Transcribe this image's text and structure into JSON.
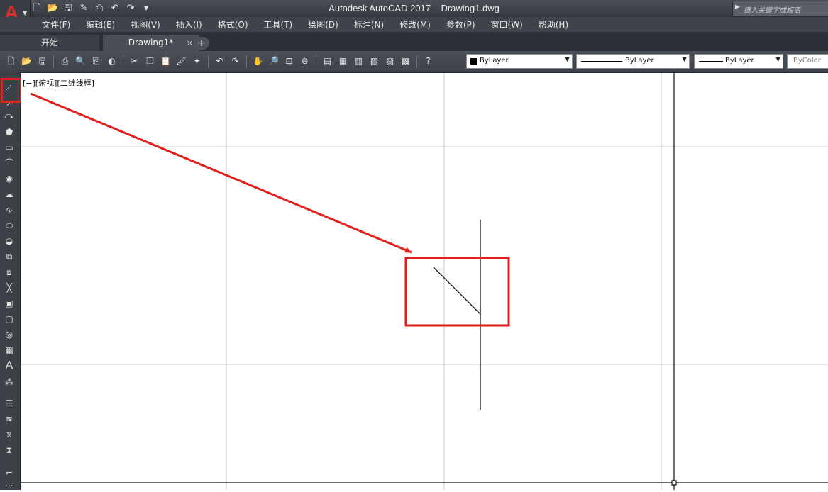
{
  "title_bar": {
    "app_name": "Autodesk AutoCAD 2017",
    "file_name": "Drawing1.dwg",
    "app_logo": "A",
    "search_placeholder": "键入关键字或短语",
    "qat_icons": [
      "new-file-icon",
      "open-folder-icon",
      "save-icon",
      "save-as-icon",
      "print-icon",
      "undo-icon",
      "redo-icon",
      "qat-dropdown-icon"
    ]
  },
  "menu": {
    "items": [
      "文件(F)",
      "编辑(E)",
      "视图(V)",
      "插入(I)",
      "格式(O)",
      "工具(T)",
      "绘图(D)",
      "标注(N)",
      "修改(M)",
      "参数(P)",
      "窗口(W)",
      "帮助(H)"
    ]
  },
  "tabs": {
    "start": "开始",
    "drawing": "Drawing1*",
    "close": "×",
    "add": "+"
  },
  "properties": {
    "color": "ByLayer",
    "linetype": "ByLayer",
    "lineweight": "ByLayer",
    "plotstyle": "ByColor"
  },
  "viewport": {
    "label": "[−][俯视][二维线框]"
  },
  "colors": {
    "annotation_red": "#e0201c",
    "grid_line": "#c8c8c8",
    "drawing_line": "#111111",
    "title_bar": "#3f434a"
  }
}
